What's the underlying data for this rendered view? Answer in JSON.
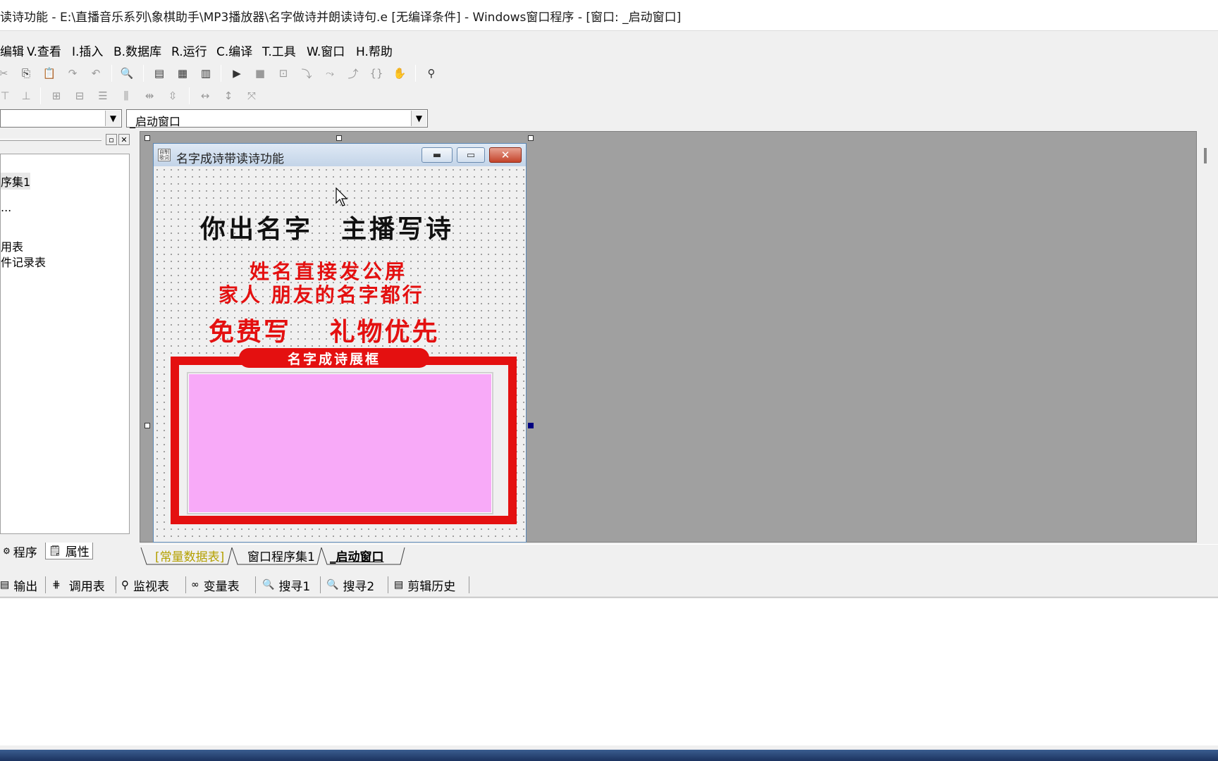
{
  "window": {
    "title": "读诗功能 - E:\\直播音乐系列\\象棋助手\\MP3播放器\\名字做诗并朗读诗句.e [无编译条件] - Windows窗口程序 - [窗口: _启动窗口]"
  },
  "menu": [
    "编辑",
    "V.查看",
    "I.插入",
    "B.数据库",
    "R.运行",
    "C.编译",
    "T.工具",
    "W.窗口",
    "H.帮助"
  ],
  "selectors": {
    "object_value": "",
    "window_value": "_启动窗口"
  },
  "left_panel": {
    "tree": [
      "序集1",
      "...",
      "用表",
      "件记录表"
    ],
    "tabs": [
      "程序",
      "属性"
    ]
  },
  "form": {
    "caption": "名字成诗带读诗功能",
    "icon_text": "自制 歌词",
    "line1": "你出名字　主播写诗",
    "line2": "姓名直接发公屏",
    "line3": "家人 朋友的名字都行",
    "line4": "免费写　 礼物优先",
    "banner": "名字成诗展框",
    "colors": {
      "accent_red": "#e41010",
      "panel_pink": "#f8aaf8"
    }
  },
  "doc_tabs": [
    "[常量数据表]",
    "窗口程序集1",
    "_启动窗口"
  ],
  "output_tabs": [
    "输出",
    "调用表",
    "监视表",
    "变量表",
    "搜寻1",
    "搜寻2",
    "剪辑历史"
  ]
}
